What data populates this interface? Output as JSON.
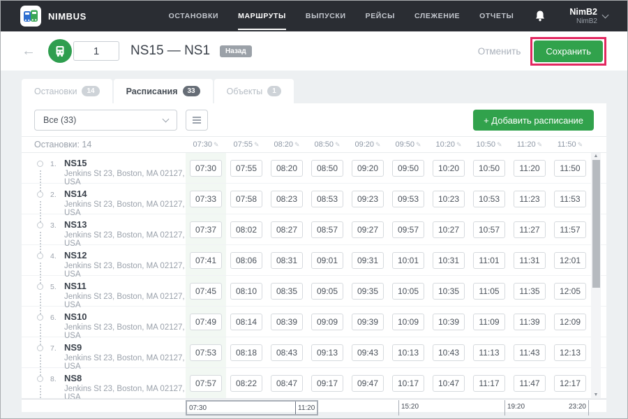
{
  "nav": {
    "brand": "NIMBUS",
    "items": [
      {
        "label": "ОСТАНОВКИ",
        "active": false
      },
      {
        "label": "МАРШРУТЫ",
        "active": true
      },
      {
        "label": "ВЫПУСКИ",
        "active": false
      },
      {
        "label": "РЕЙСЫ",
        "active": false
      },
      {
        "label": "СЛЕЖЕНИЕ",
        "active": false
      },
      {
        "label": "ОТЧЕТЫ",
        "active": false
      }
    ],
    "user": {
      "name": "NimB2",
      "subtitle": "NimB2"
    }
  },
  "header": {
    "back_icon": "←",
    "route_number": "1",
    "title": "NS15 — NS1",
    "badge": "Назад",
    "cancel_label": "Отменить",
    "save_label": "Сохранить"
  },
  "tabs": [
    {
      "label": "Остановки",
      "count": "14",
      "active": false
    },
    {
      "label": "Расписания",
      "count": "33",
      "active": true
    },
    {
      "label": "Объекты",
      "count": "1",
      "active": false
    }
  ],
  "toolbar": {
    "filter_value": "Все (33)",
    "add_label": "+ Добавить расписание"
  },
  "schedule_table": {
    "stops_header": "Остановки: 14",
    "columns": [
      "07:30",
      "07:55",
      "08:20",
      "08:50",
      "09:20",
      "09:50",
      "10:20",
      "10:50",
      "11:20",
      "11:50"
    ],
    "rows": [
      {
        "num": "1.",
        "name": "NS15",
        "address": "Jenkins St 23, Boston, MA 02127, USA",
        "times": [
          "07:30",
          "07:55",
          "08:20",
          "08:50",
          "09:20",
          "09:50",
          "10:20",
          "10:50",
          "11:20",
          "11:50"
        ]
      },
      {
        "num": "2.",
        "name": "NS14",
        "address": "Jenkins St 23, Boston, MA 02127, USA",
        "times": [
          "07:33",
          "07:58",
          "08:23",
          "08:53",
          "09:23",
          "09:53",
          "10:23",
          "10:53",
          "11:23",
          "11:53"
        ]
      },
      {
        "num": "3.",
        "name": "NS13",
        "address": "Jenkins St 23, Boston, MA 02127, USA",
        "times": [
          "07:37",
          "08:02",
          "08:27",
          "08:57",
          "09:27",
          "09:57",
          "10:27",
          "10:57",
          "11:27",
          "11:57"
        ]
      },
      {
        "num": "4.",
        "name": "NS12",
        "address": "Jenkins St 23, Boston, MA 02127, USA",
        "times": [
          "07:41",
          "08:06",
          "08:31",
          "09:01",
          "09:31",
          "10:01",
          "10:31",
          "11:01",
          "11:31",
          "12:01"
        ]
      },
      {
        "num": "5.",
        "name": "NS11",
        "address": "Jenkins St 23, Boston, MA 02127, USA",
        "times": [
          "07:45",
          "08:10",
          "08:35",
          "09:05",
          "09:35",
          "10:05",
          "10:35",
          "11:05",
          "11:35",
          "12:05"
        ]
      },
      {
        "num": "6.",
        "name": "NS10",
        "address": "Jenkins St 23, Boston, MA 02127, USA",
        "times": [
          "07:49",
          "08:14",
          "08:39",
          "09:09",
          "09:39",
          "10:09",
          "10:39",
          "11:09",
          "11:39",
          "12:09"
        ]
      },
      {
        "num": "7.",
        "name": "NS9",
        "address": "Jenkins St 23, Boston, MA 02127, USA",
        "times": [
          "07:53",
          "08:18",
          "08:43",
          "09:13",
          "09:43",
          "10:13",
          "10:43",
          "11:13",
          "11:43",
          "12:13"
        ]
      },
      {
        "num": "8.",
        "name": "NS8",
        "address": "Jenkins St 23, Boston, MA 02127, USA",
        "times": [
          "07:57",
          "08:22",
          "08:47",
          "09:17",
          "09:47",
          "10:17",
          "10:47",
          "11:17",
          "11:47",
          "12:17"
        ]
      }
    ]
  },
  "timeline": {
    "range_start": "07:30",
    "range_end": "11:20",
    "ticks": [
      "15:20",
      "19:20"
    ],
    "end_label": "23:20"
  },
  "colors": {
    "accent_green": "#31a24c",
    "nav_bg": "#2a2d33",
    "highlight_red": "#e2265f",
    "column_tint": "#f2f8f3"
  }
}
